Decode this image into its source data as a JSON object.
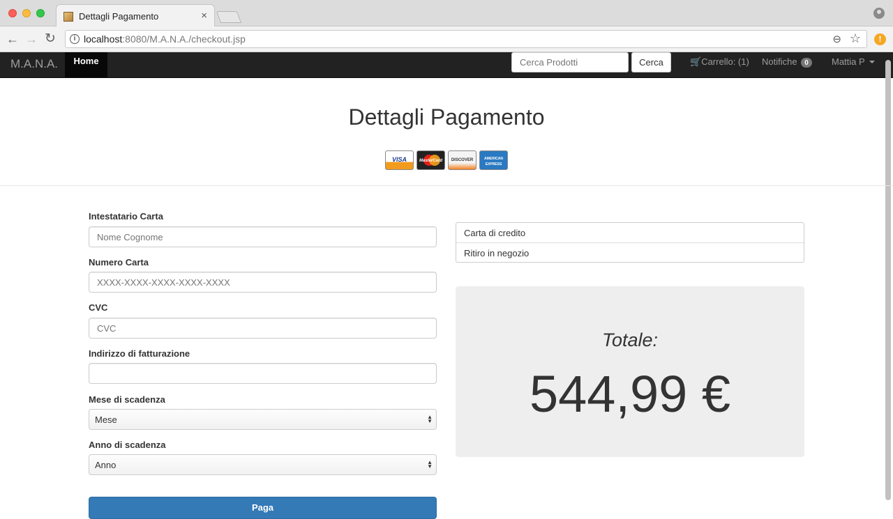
{
  "browser": {
    "tab_title": "Dettagli Pagamento",
    "tab_close": "×",
    "url_host": "localhost",
    "url_path": ":8080/M.A.N.A./checkout.jsp",
    "alert_badge": "!"
  },
  "navbar": {
    "brand": "M.A.N.A.",
    "home": "Home",
    "search_placeholder": "Cerca Prodotti",
    "search_button": "Cerca",
    "cart": "Carrello: (1)",
    "notifications": "Notifiche",
    "notifications_count": "0",
    "user": "Mattia P"
  },
  "page": {
    "title": "Dettagli Pagamento",
    "cards": {
      "visa": "VISA",
      "mastercard": "MasterCard",
      "discover": "DISCOVER",
      "amex": "AMERICAN EXPRESS"
    }
  },
  "form": {
    "holder_label": "Intestatario Carta",
    "holder_placeholder": "Nome Cognome",
    "number_label": "Numero Carta",
    "number_placeholder": "XXXX-XXXX-XXXX-XXXX-XXXX",
    "cvc_label": "CVC",
    "cvc_placeholder": "CVC",
    "address_label": "Indirizzo di fatturazione",
    "address_value": "",
    "month_label": "Mese di scadenza",
    "month_value": "Mese",
    "year_label": "Anno di scadenza",
    "year_value": "Anno",
    "pay_button": "Paga"
  },
  "payment_methods": [
    "Carta di credito",
    "Ritiro in negozio"
  ],
  "summary": {
    "total_label": "Totale:",
    "total_amount": "544,99 €"
  },
  "colors": {
    "navbar_bg": "#222222",
    "primary_button": "#337ab7",
    "total_box_bg": "#eeeeee"
  }
}
